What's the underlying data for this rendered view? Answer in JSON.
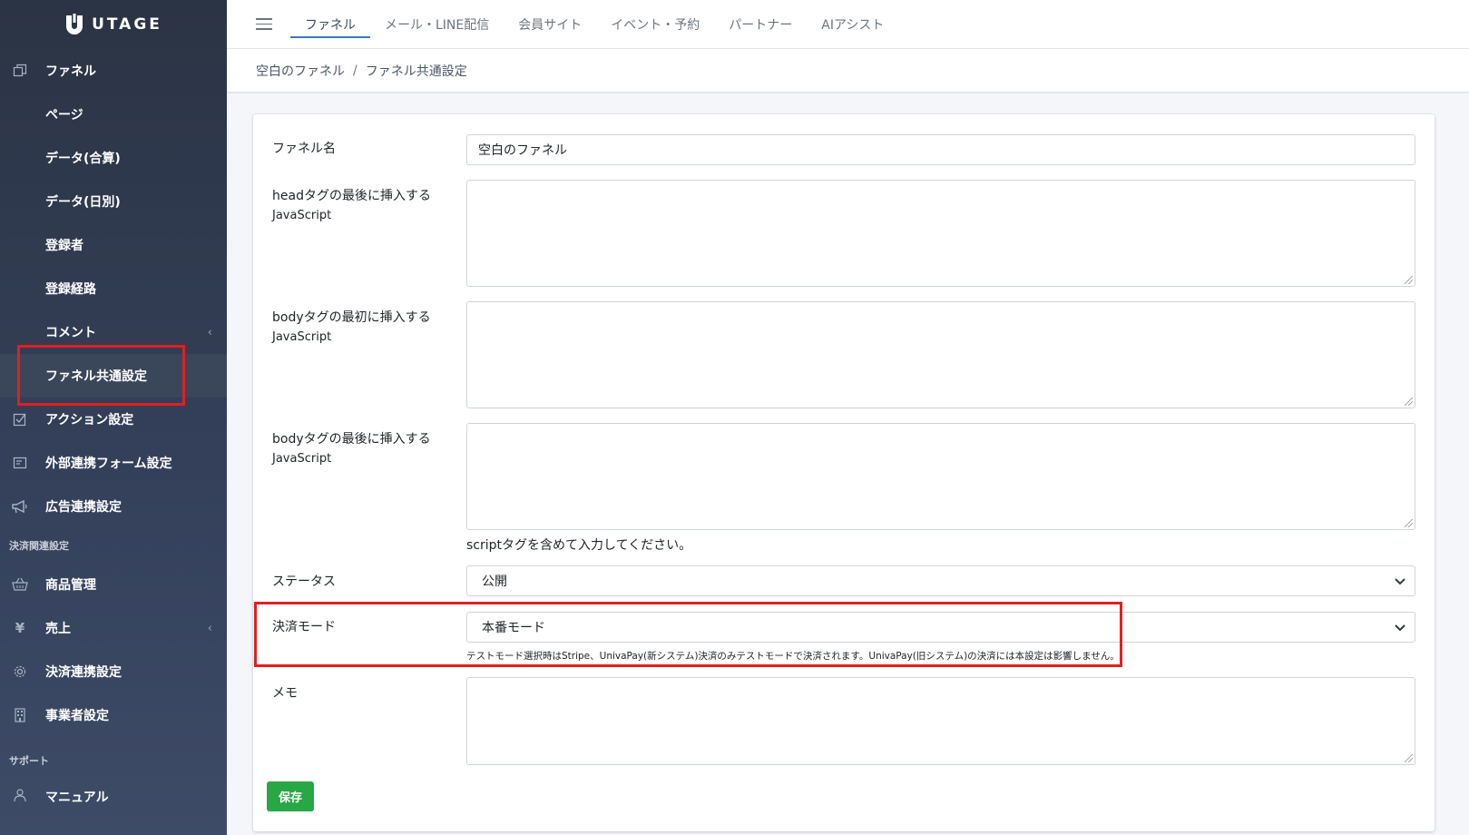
{
  "app": {
    "logo_text": "UTAGE"
  },
  "sidebar": {
    "items": [
      {
        "label": "ファネル",
        "icon": "copy-icon"
      },
      {
        "label": "ページ"
      },
      {
        "label": "データ(合算)"
      },
      {
        "label": "データ(日別)"
      },
      {
        "label": "登録者"
      },
      {
        "label": "登録経路"
      },
      {
        "label": "コメント",
        "chevron": "‹"
      },
      {
        "label": "ファネル共通設定"
      },
      {
        "label": "アクション設定",
        "icon": "checkbox-icon"
      },
      {
        "label": "外部連携フォーム設定",
        "icon": "form-icon"
      },
      {
        "label": "広告連携設定",
        "icon": "megaphone-icon"
      }
    ],
    "section_payment": "決済関連設定",
    "payment_items": [
      {
        "label": "商品管理",
        "icon": "basket-icon"
      },
      {
        "label": "売上",
        "icon": "yen-icon",
        "glyph": "¥",
        "chevron": "‹"
      },
      {
        "label": "決済連携設定",
        "icon": "gear-icon"
      },
      {
        "label": "事業者設定",
        "icon": "building-icon"
      }
    ],
    "section_support": "サポート",
    "support_items": [
      {
        "label": "マニュアル",
        "icon": "user-icon"
      }
    ]
  },
  "topnav": {
    "tabs": [
      {
        "label": "ファネル",
        "active": true
      },
      {
        "label": "メール・LINE配信"
      },
      {
        "label": "会員サイト"
      },
      {
        "label": "イベント・予約"
      },
      {
        "label": "パートナー"
      },
      {
        "label": "AIアシスト"
      }
    ]
  },
  "breadcrumb": {
    "parent": "空白のファネル",
    "separator": "/",
    "current": "ファネル共通設定"
  },
  "form": {
    "funnel_name": {
      "label": "ファネル名",
      "value": "空白のファネル"
    },
    "head_js": {
      "label_line1": "headタグの最後に挿入する",
      "label_line2": "JavaScript",
      "value": ""
    },
    "body_start_js": {
      "label_line1": "bodyタグの最初に挿入する",
      "label_line2": "JavaScript",
      "value": ""
    },
    "body_end_js": {
      "label_line1": "bodyタグの最後に挿入する",
      "label_line2": "JavaScript",
      "value": "",
      "help": "scriptタグを含めて入力してください。"
    },
    "status": {
      "label": "ステータス",
      "value": "公開"
    },
    "payment_mode": {
      "label": "決済モード",
      "value": "本番モード",
      "help": "テストモード選択時はStripe、UnivaPay(新システム)決済のみテストモードで決済されます。UnivaPay(旧システム)の決済には本設定は影響しません。"
    },
    "memo": {
      "label": "メモ",
      "value": ""
    },
    "save_label": "保存"
  },
  "colors": {
    "highlight": "#e02020",
    "save_button": "#28a745",
    "tab_underline": "#3b78c5"
  }
}
